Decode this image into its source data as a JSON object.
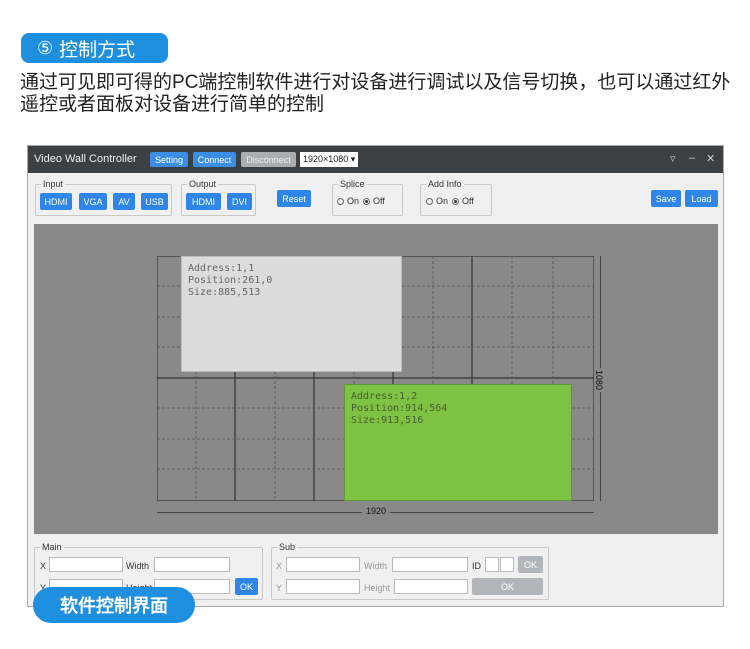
{
  "section": {
    "number": "⑤",
    "title": "控制方式"
  },
  "intro_text": "通过可见即可得的PC端控制软件进行对设备进行调试以及信号切换，也可以通过红外遥控或者面板对设备进行简单的控制",
  "app": {
    "title": "Video Wall Controller",
    "toolbar": {
      "setting": "Setting",
      "connect": "Connect",
      "disconnect": "Disconnect",
      "resolution": "1920×1080 ▾"
    },
    "window_controls": {
      "menu": "▿",
      "minimize": "–",
      "close": "✕"
    },
    "input": {
      "legend": "Input",
      "buttons": [
        "HDMI",
        "VGA",
        "AV",
        "USB"
      ]
    },
    "output": {
      "legend": "Output",
      "buttons": [
        "HDMI",
        "DVI"
      ]
    },
    "reset": "Reset",
    "splice": {
      "legend": "Splice",
      "on": "On",
      "off": "Off",
      "selected": "Off"
    },
    "add_info": {
      "legend": "Add Info",
      "on": "On",
      "off": "Off",
      "selected": "Off"
    },
    "save": "Save",
    "load": "Load",
    "wall": {
      "width_label": "1920",
      "height_label": "1080",
      "windows": [
        {
          "address": "Address:1,1",
          "position": "Position:261,0",
          "size": "Size:885,513"
        },
        {
          "address": "Address:1,2",
          "position": "Position:914,564",
          "size": "Size:913,516"
        }
      ]
    },
    "main_panel": {
      "legend": "Main",
      "x": "X",
      "y": "Y",
      "width": "Width",
      "height": "Height",
      "ok": "OK"
    },
    "sub_panel": {
      "legend": "Sub",
      "x": "X",
      "y": "Y",
      "width": "Width",
      "height": "Height",
      "id": "ID",
      "ok_small": "OK",
      "ok": "OK"
    }
  },
  "caption": "软件控制界面",
  "colors": {
    "accent": "#1f8fe0",
    "button": "#2f86e8",
    "active_window": "#7dc242",
    "canvas": "#898989"
  }
}
